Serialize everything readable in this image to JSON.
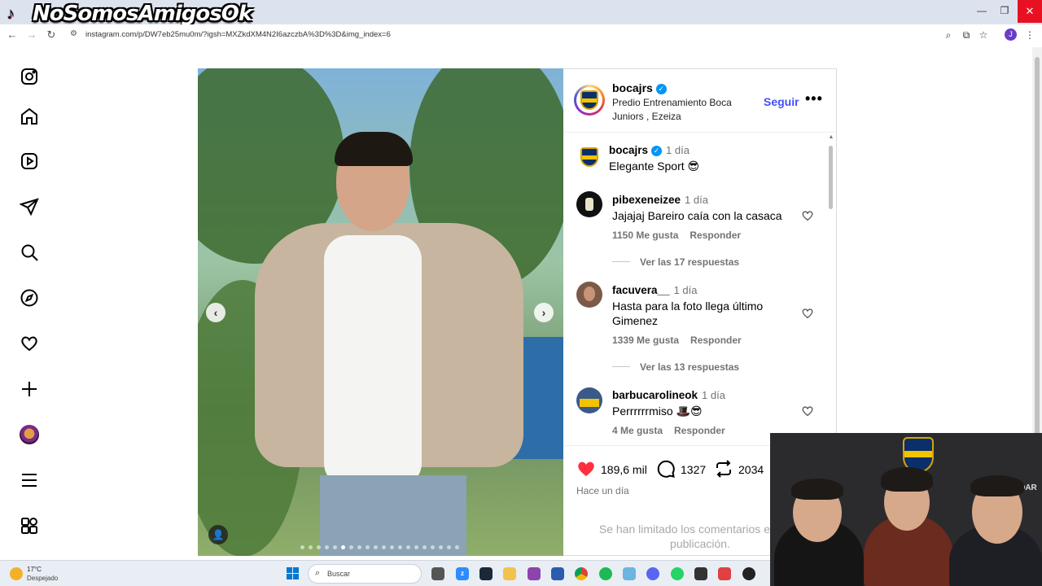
{
  "overlay": {
    "channel_title": "NoSomosAmigosOk"
  },
  "browser": {
    "url": "instagram.com/p/DW7eb25mu0m/?igsh=MXZkdXM4N2I6azczbA%3D%3D&img_index=6",
    "profile_initial": "J"
  },
  "sidebar": {
    "icons": [
      "instagram-icon",
      "home-icon",
      "reels-icon",
      "messages-icon",
      "search-icon",
      "explore-icon",
      "notifications-icon",
      "create-icon",
      "profile-avatar",
      "more-icon",
      "also-from-meta-icon"
    ]
  },
  "post": {
    "carousel": {
      "total": 20,
      "active_index": 6
    },
    "header": {
      "username": "bocajrs",
      "location": "Predio Entrenamiento Boca Juniors , Ezeiza",
      "follow_label": "Seguir",
      "more_label": "•••"
    },
    "caption": {
      "username": "bocajrs",
      "time": "1 día",
      "text": "Elegante Sport 😎"
    },
    "comments": [
      {
        "username": "pibexeneizee",
        "time": "1 día",
        "text": "Jajajaj Bareiro caía con la casaca",
        "likes": "1150 Me gusta",
        "reply_label": "Responder",
        "replies": "Ver las 17 respuestas"
      },
      {
        "username": "facuvera__",
        "time": "1 día",
        "text": "Hasta para la foto llega último Gimenez",
        "likes": "1339 Me gusta",
        "reply_label": "Responder",
        "replies": "Ver las 13 respuestas"
      },
      {
        "username": "barbucarolineok",
        "time": "1 día",
        "text": "Perrrrrrmiso 🎩😎",
        "likes": "4 Me gusta",
        "reply_label": "Responder"
      }
    ],
    "stats": {
      "likes": "189,6 mil",
      "comments": "1327",
      "reposts": "2034"
    },
    "posted": "Hace un día",
    "limited_message": "Se han limitado los comentarios en esta publicación."
  },
  "taskbar": {
    "weather_temp": "17°C",
    "weather_desc": "Despejado",
    "search_label": "Buscar"
  },
  "webcam": {
    "sign_text": "LDAR"
  },
  "colors": {
    "accent": "#4150f7",
    "like_red": "#ff3040",
    "verified": "#0095f6",
    "close": "#e81123"
  }
}
